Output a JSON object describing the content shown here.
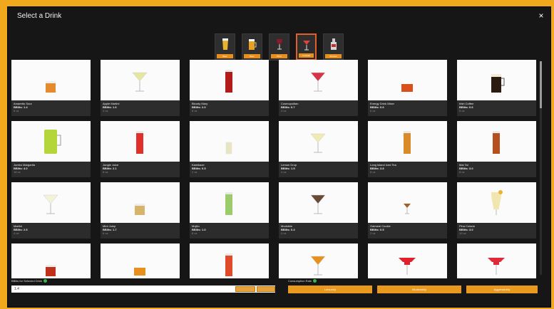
{
  "dialog": {
    "title": "Select a Drink",
    "close": "×"
  },
  "categories": [
    {
      "label": "Beer",
      "icon": "beer-glass-icon",
      "active": false
    },
    {
      "label": "Beer",
      "icon": "beer-mug-icon",
      "active": false
    },
    {
      "label": "Wine",
      "icon": "wine-glass-icon",
      "active": false
    },
    {
      "label": "Cocktail",
      "icon": "cocktail-glass-icon",
      "active": true
    },
    {
      "label": "Shooter",
      "icon": "liquor-bottle-icon",
      "active": false
    }
  ],
  "drinks": [
    {
      "name": "Amaretto Sour",
      "bibs": "BBlits: 1.4",
      "size": "6 oz",
      "glass": "rocks",
      "liquid": "#e68a2e"
    },
    {
      "name": "Apple Martini",
      "bibs": "BBlits: 1.6",
      "size": "4 oz",
      "glass": "martini",
      "liquid": "#e6e6a0"
    },
    {
      "name": "Bloody Mary",
      "bibs": "BBlits: 2.0",
      "size": "8 oz",
      "glass": "tall",
      "liquid": "#b31a1a"
    },
    {
      "name": "Cosmopolitan",
      "bibs": "BBlits: 0.7",
      "size": "4 oz",
      "glass": "martini",
      "liquid": "#d9334a"
    },
    {
      "name": "Energy Drink Mixer",
      "bibs": "BBlits: 0.6",
      "size": "6 oz",
      "glass": "short",
      "liquid": "#d9501a"
    },
    {
      "name": "Irish Coffee",
      "bibs": "BBlits: 0.6",
      "size": "6 oz",
      "glass": "mug",
      "liquid": "#2a1a10"
    },
    {
      "name": "Jumbo Margarita",
      "bibs": "BBlits: 4.0",
      "size": "18 oz",
      "glass": "jumbo",
      "liquid": "#b4d63a"
    },
    {
      "name": "Jungle Juice",
      "bibs": "BBlits: 2.1",
      "size": "8 oz",
      "glass": "tall",
      "liquid": "#e0302a"
    },
    {
      "name": "Kamikaze",
      "bibs": "BBlits: 0.5",
      "size": "2 oz",
      "glass": "shot",
      "liquid": "#e8e6c0"
    },
    {
      "name": "Lemon Drop",
      "bibs": "BBlits: 1.5",
      "size": "4 oz",
      "glass": "martini",
      "liquid": "#f0ebb0"
    },
    {
      "name": "Long Island Iced Tea",
      "bibs": "BBlits: 3.8",
      "size": "8 oz",
      "glass": "tall",
      "liquid": "#d98a2a"
    },
    {
      "name": "Mai Tai",
      "bibs": "BBlits: 3.0",
      "size": "8 oz",
      "glass": "tall",
      "liquid": "#b5501e"
    },
    {
      "name": "Martini",
      "bibs": "BBlits: 2.5",
      "size": "4 oz",
      "glass": "martini",
      "liquid": "#f4f2d8"
    },
    {
      "name": "Mint Julep",
      "bibs": "BBlits: 1.7",
      "size": "6 oz",
      "glass": "rocks",
      "liquid": "#d8b46a"
    },
    {
      "name": "Mojito",
      "bibs": "BBlits: 1.0",
      "size": "8 oz",
      "glass": "tall",
      "liquid": "#9ccc6a"
    },
    {
      "name": "Mudslide",
      "bibs": "BBlits: 0.4",
      "size": "4 oz",
      "glass": "martini",
      "liquid": "#6a4a34"
    },
    {
      "name": "Oatmeal Cookie",
      "bibs": "BBlits: 0.5",
      "size": "2 oz",
      "glass": "martini-small",
      "liquid": "#a0602a"
    },
    {
      "name": "Pina Colada",
      "bibs": "BBlits: 3.0",
      "size": "10 oz",
      "glass": "hurricane",
      "liquid": "#f2e6b0"
    },
    {
      "name": "",
      "bibs": "",
      "size": "",
      "glass": "rocks",
      "liquid": "#c0301a"
    },
    {
      "name": "",
      "bibs": "",
      "size": "",
      "glass": "short",
      "liquid": "#e8901e"
    },
    {
      "name": "",
      "bibs": "",
      "size": "",
      "glass": "tall",
      "liquid": "#e04a2a"
    },
    {
      "name": "",
      "bibs": "",
      "size": "",
      "glass": "martini",
      "liquid": "#e8901e"
    },
    {
      "name": "",
      "bibs": "",
      "size": "",
      "glass": "margarita",
      "liquid": "#e0202a"
    },
    {
      "name": "",
      "bibs": "",
      "size": "",
      "glass": "margarita",
      "liquid": "#e02a3a"
    }
  ],
  "bottom": {
    "bibs_label": "BBlits for Selected Drink",
    "bibs_value": "1.4",
    "rate_label": "Consumption Rate",
    "rate_buttons": [
      "Leisurely",
      "Moderately",
      "Aggressively"
    ]
  }
}
